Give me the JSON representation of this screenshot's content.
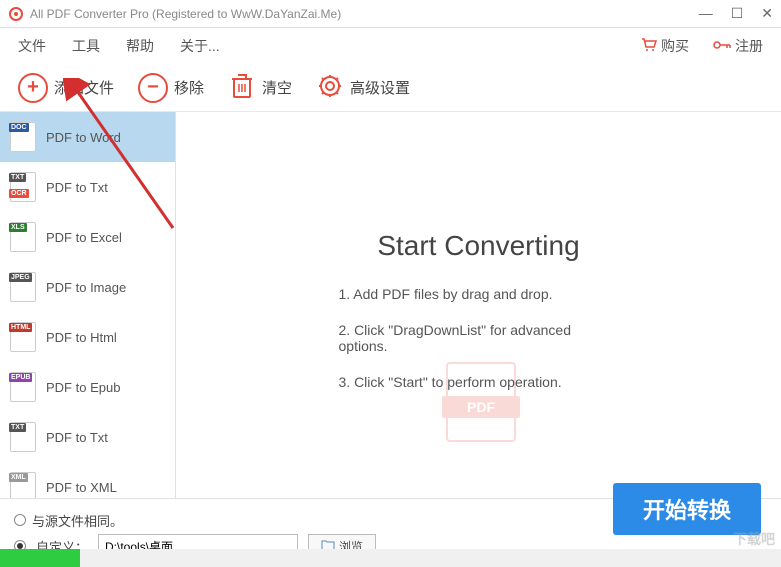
{
  "titlebar": {
    "title": "All PDF Converter Pro (Registered to WwW.DaYanZai.Me)"
  },
  "menubar": {
    "items": [
      "文件",
      "工具",
      "帮助",
      "关于..."
    ],
    "buy": "购买",
    "register": "注册"
  },
  "toolbar": {
    "add": "添加文件",
    "remove": "移除",
    "clear": "清空",
    "settings": "高级设置"
  },
  "sidebar": {
    "items": [
      {
        "label": "PDF to Word",
        "tag": "DOC",
        "tagClass": "tag-doc",
        "active": true
      },
      {
        "label": "PDF to Txt",
        "tag": "TXT",
        "tagClass": "tag-txt",
        "ocr": true
      },
      {
        "label": "PDF to Excel",
        "tag": "XLS",
        "tagClass": "tag-xls"
      },
      {
        "label": "PDF to Image",
        "tag": "JPEG",
        "tagClass": "tag-jpeg"
      },
      {
        "label": "PDF to Html",
        "tag": "HTML",
        "tagClass": "tag-html"
      },
      {
        "label": "PDF to Epub",
        "tag": "EPUB",
        "tagClass": "tag-epub"
      },
      {
        "label": "PDF to Txt",
        "tag": "TXT",
        "tagClass": "tag-txt"
      },
      {
        "label": "PDF to XML",
        "tag": "XML",
        "tagClass": "tag-xml"
      }
    ]
  },
  "main": {
    "title": "Start Converting",
    "steps": [
      "1. Add PDF files by drag and drop.",
      "2. Click \"DragDownList\" for advanced options.",
      "3. Click \"Start\" to perform operation."
    ],
    "pdf_label": "PDF"
  },
  "bottom": {
    "same_as_source": "与源文件相同。",
    "custom": "自定义：",
    "path": "D:\\tools\\桌面",
    "browse": "浏览"
  },
  "start_button": "开始转换",
  "corner_watermark": "下载吧"
}
